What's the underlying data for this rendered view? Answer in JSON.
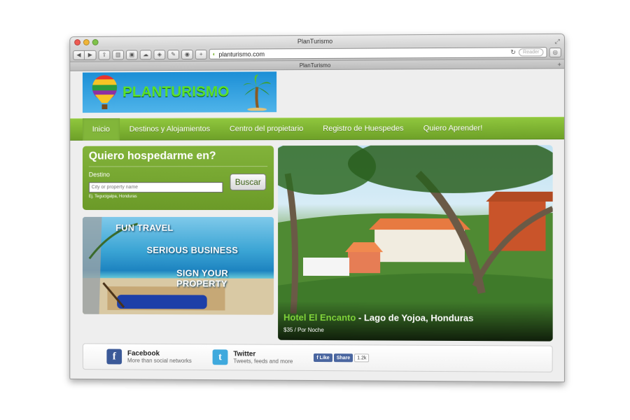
{
  "window": {
    "title": "PlanTurismo",
    "tab_title": "PlanTurismo",
    "url": "planturismo.com",
    "reader_label": "Reader"
  },
  "colors": {
    "nav_green": "#7ab232",
    "logo_text_green": "#5ae02a",
    "logo_bg_blue": "#1c8fd6",
    "hotel_name_green": "#7fd23a",
    "facebook_blue": "#3b5998",
    "twitter_blue": "#3fa9dd"
  },
  "logo": {
    "text": "PLANTURISMO",
    "icons": [
      "hot-air-balloon-icon",
      "palm-tree-icon"
    ]
  },
  "nav": {
    "items": [
      "Inicio",
      "Destinos y Alojamientos",
      "Centro del propietario",
      "Registro de Huespedes",
      "Quiero Aprender!"
    ],
    "active_index": 0
  },
  "search": {
    "title": "Quiero hospedarme en?",
    "destination_label": "Destino",
    "placeholder": "City or property name",
    "hint": "Ej. Tegucigalpa, Honduras",
    "button": "Buscar"
  },
  "promo": {
    "line1": "FUN TRAVEL",
    "line2": "SERIOUS BUSINESS",
    "line3": "SIGN YOUR PROPERTY"
  },
  "hero": {
    "hotel_name": "Hotel El Encanto",
    "separator": " - ",
    "location": "Lago de Yojoa, Honduras",
    "price": "$35 / Por Noche"
  },
  "social": {
    "facebook": {
      "title": "Facebook",
      "subtitle": "More than social networks"
    },
    "twitter": {
      "title": "Twitter",
      "subtitle": "Tweets, feeds and more"
    },
    "like_label": "Like",
    "share_label": "Share",
    "share_count": "1.2k"
  }
}
